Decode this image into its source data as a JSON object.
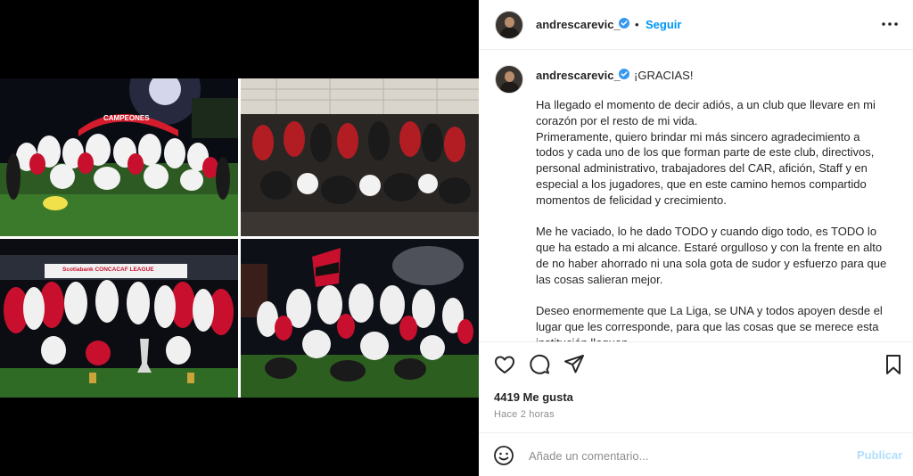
{
  "post": {
    "username": "andrescarevic_",
    "follow_label": "Seguir",
    "dot": "•",
    "caption_first_line": "¡GRACIAS!",
    "caption_body": "Ha llegado el momento de decir adiós, a un club que llevare en mi corazón por el resto de mi vida.\nPrimeramente, quiero brindar mi más sincero agradecimiento a todos y cada uno de los que forman parte de este club, directivos, personal administrativo, trabajadores del CAR, afición, Staff y en especial a los jugadores, que en este camino hemos compartido momentos de felicidad y crecimiento.\n\nMe he vaciado, lo he dado TODO y cuando digo todo, es TODO lo que ha estado a mi alcance. Estaré orgulloso y con la frente en alto de no haber ahorrado ni una sola gota de sudor y esfuerzo para que las cosas salieran mejor.\n\nDeseo enormemente que La Liga, se UNA y todos apoyen desde el lugar que les corresponde, para que las cosas que se merece esta institución lleguen.",
    "likes": "4419 Me gusta",
    "time": "Hace 2 horas",
    "comment_placeholder": "Añade un comentario...",
    "publish_label": "Publicar"
  },
  "media": {
    "banner_campeones": "CAMPEONES",
    "banner_concacaf": "Scotiabank CONCACAF LEAGUE"
  },
  "icons": [
    "verified-icon",
    "more-options-icon",
    "heart-icon",
    "comment-icon",
    "share-icon",
    "bookmark-icon",
    "emoji-icon"
  ],
  "colors": {
    "accent": "#0095f6",
    "verified": "#3897f0",
    "publish_disabled": "#b2dffc",
    "muted": "#8e8e8e",
    "text": "#262626",
    "jersey_red": "#c8102e"
  }
}
